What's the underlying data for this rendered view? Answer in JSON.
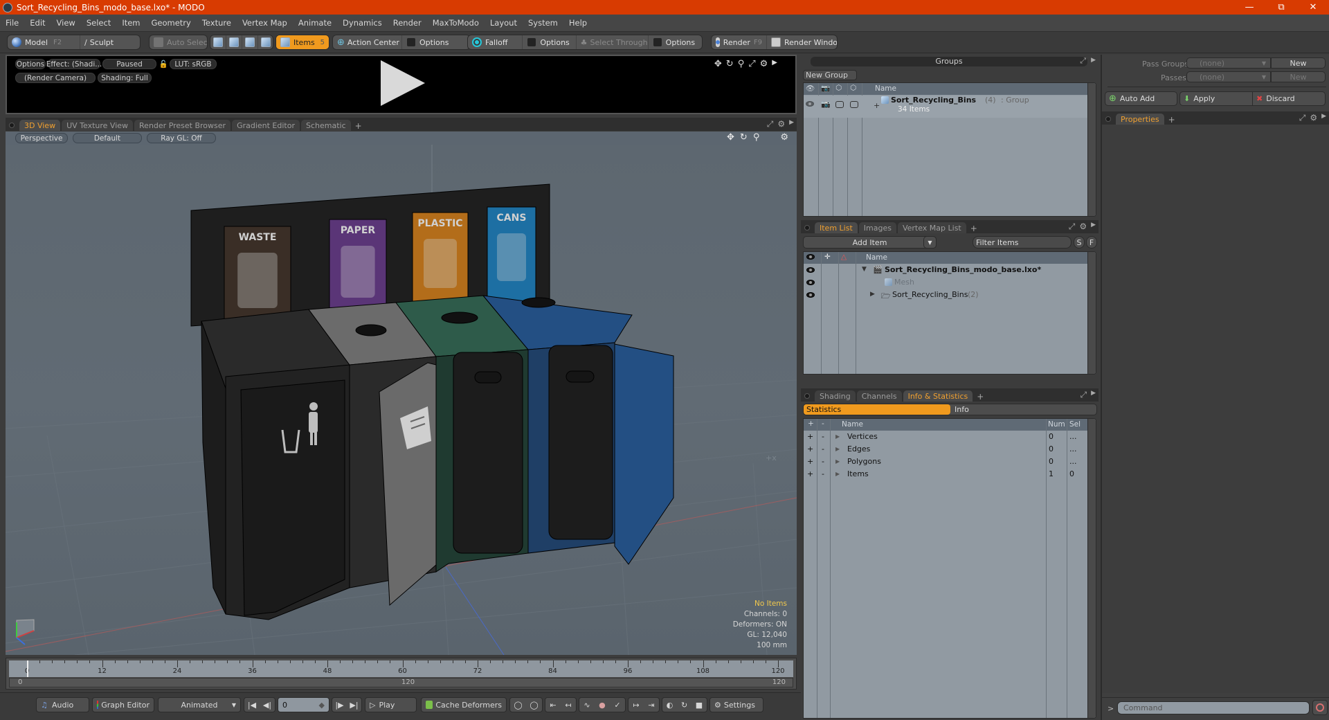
{
  "window": {
    "title": "Sort_Recycling_Bins_modo_base.lxo* - MODO",
    "controls": [
      "minimize",
      "restore",
      "close"
    ]
  },
  "menu": [
    "File",
    "Edit",
    "View",
    "Select",
    "Item",
    "Geometry",
    "Texture",
    "Vertex Map",
    "Animate",
    "Dynamics",
    "Render",
    "MaxToModo",
    "Layout",
    "System",
    "Help"
  ],
  "toolbar": {
    "model": "Model",
    "model_key": "F2",
    "sculpt": "Sculpt",
    "auto_select": "Auto Select",
    "items": "Items",
    "items_key": "5",
    "action_center": "Action Center",
    "options1": "Options",
    "falloff": "Falloff",
    "options2": "Options",
    "select_through": "Select Through",
    "options3": "Options",
    "render": "Render",
    "render_key": "F9",
    "render_window": "Render Window"
  },
  "render_preview": {
    "options": "Options",
    "effect": "Effect: (Shadi...",
    "paused": "Paused",
    "lut": "LUT: sRGB",
    "camera": "(Render Camera)",
    "shading": "Shading: Full"
  },
  "viewport_tabs": [
    "3D View",
    "UV Texture View",
    "Render Preset Browser",
    "Gradient Editor",
    "Schematic"
  ],
  "viewport_toolbar": {
    "projection": "Perspective",
    "style": "Default",
    "raygl": "Ray GL: Off"
  },
  "viewport_stats": {
    "selection": "No Items",
    "channels": "Channels: 0",
    "deformers": "Deformers: ON",
    "gl": "GL: 12,040",
    "unit": "100 mm"
  },
  "scene": {
    "signs": [
      {
        "label": "WASTE",
        "color": "#3a2e26"
      },
      {
        "label": "PAPER",
        "color": "#5a3577"
      },
      {
        "label": "PLASTIC",
        "color": "#b36d1a"
      },
      {
        "label": "CANS",
        "color": "#1d6fa3"
      }
    ],
    "lid_colors": [
      "#2a2a2a",
      "#6b6b6b",
      "#2e5b4a",
      "#234f83"
    ]
  },
  "timeline": {
    "ticks": [
      "0",
      "12",
      "24",
      "36",
      "48",
      "60",
      "72",
      "84",
      "96",
      "108",
      "120"
    ],
    "range_start": "0",
    "range_mid": "120",
    "range_end": "120"
  },
  "bottom": {
    "audio": "Audio",
    "graph_editor": "Graph Editor",
    "animated": "Animated",
    "frame": "0",
    "play": "Play",
    "cache_deformers": "Cache Deformers",
    "settings": "Settings"
  },
  "groups": {
    "title": "Groups",
    "new_group": "New Group",
    "col_name": "Name",
    "row": {
      "name": "Sort_Recycling_Bins",
      "count": "(4)",
      "type": ": Group",
      "items": "34 Items"
    }
  },
  "passes": {
    "pass_groups_label": "Pass Groups",
    "pass_groups_value": "(none)",
    "new1": "New",
    "passes_label": "Passes",
    "passes_value": "(none)",
    "new2": "New",
    "auto_add": "Auto Add",
    "apply": "Apply",
    "discard": "Discard"
  },
  "properties": {
    "tab": "Properties"
  },
  "item_list": {
    "tabs": [
      "Item List",
      "Images",
      "Vertex Map List"
    ],
    "add_item": "Add Item",
    "filter_placeholder": "Filter Items",
    "s": "S",
    "f": "F",
    "col_name": "Name",
    "rows": [
      {
        "name": "Sort_Recycling_Bins_modo_base.lxo*",
        "suffix": ""
      },
      {
        "name": "Mesh",
        "suffix": ""
      },
      {
        "name": "Sort_Recycling_Bins",
        "suffix": "(2)"
      }
    ]
  },
  "info": {
    "tabs": [
      "Shading",
      "Channels",
      "Info & Statistics"
    ],
    "subtabs": [
      "Statistics",
      "Info"
    ],
    "cols": {
      "plus": "+",
      "minus": "-",
      "name": "Name",
      "num": "Num",
      "sel": "Sel"
    },
    "rows": [
      {
        "name": "Vertices",
        "num": "0",
        "sel": "..."
      },
      {
        "name": "Edges",
        "num": "0",
        "sel": "..."
      },
      {
        "name": "Polygons",
        "num": "0",
        "sel": "..."
      },
      {
        "name": "Items",
        "num": "1",
        "sel": "0"
      }
    ]
  },
  "command": {
    "placeholder": "Command",
    "prompt": ">"
  }
}
